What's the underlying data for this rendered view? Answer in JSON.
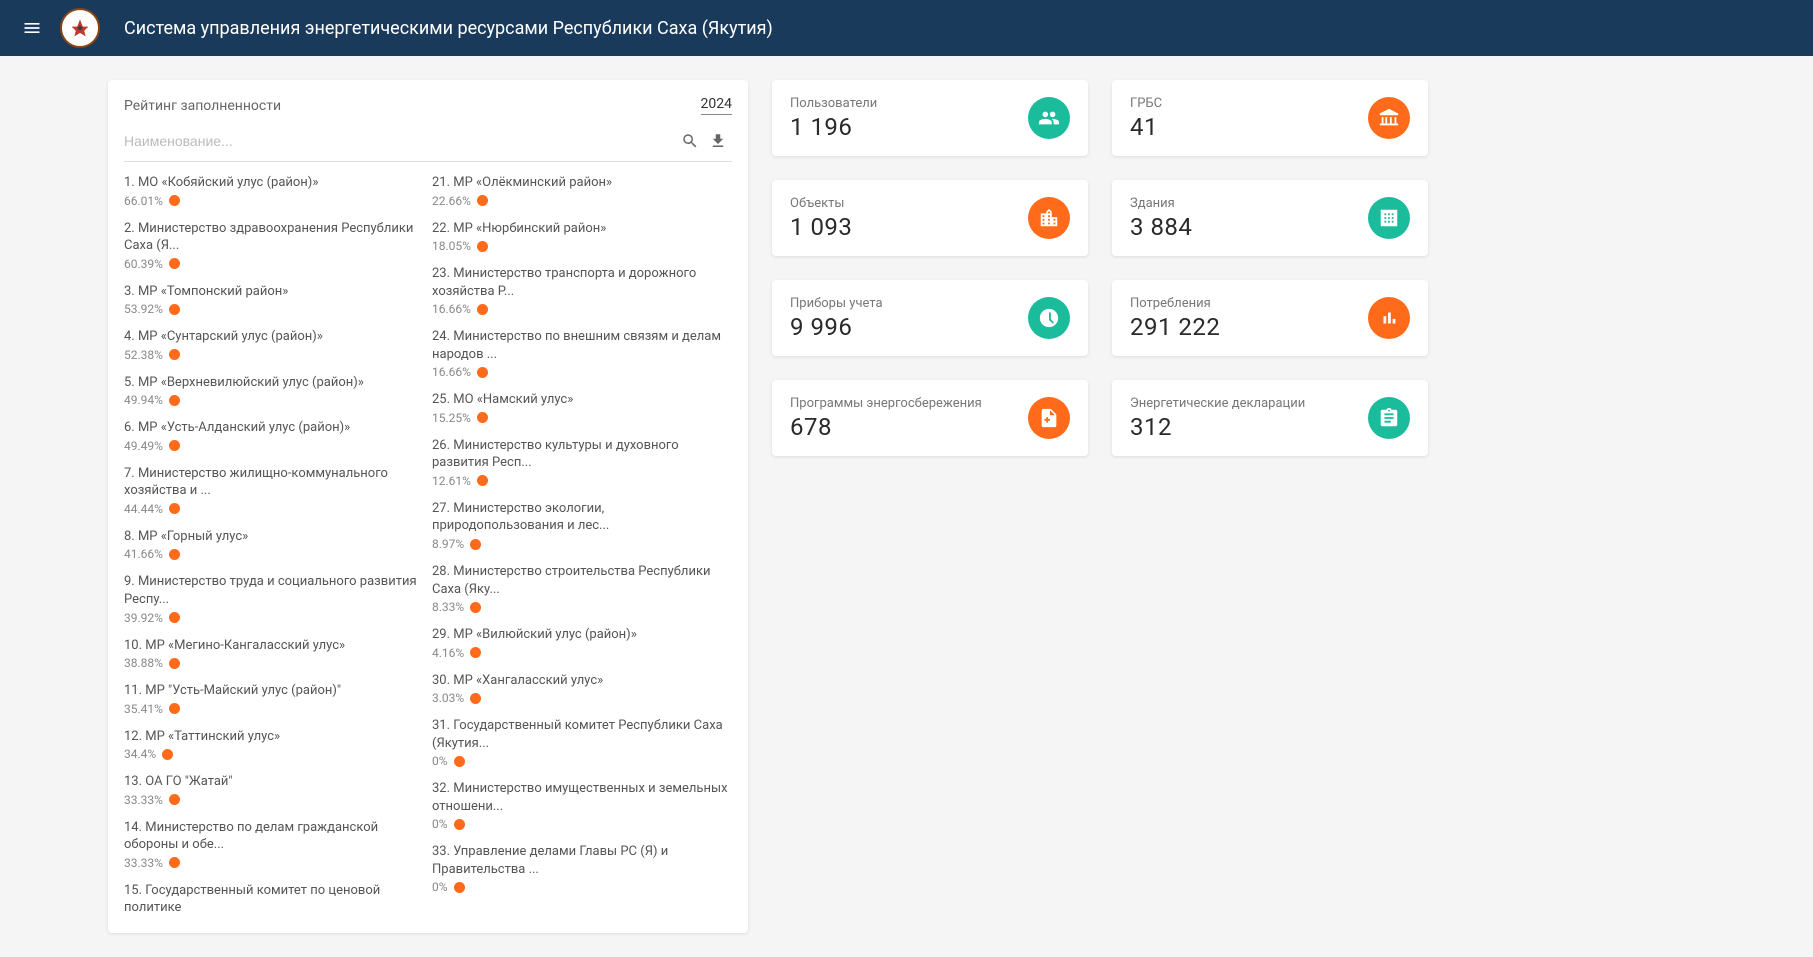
{
  "header": {
    "title": "Система управления энергетическими ресурсами Республики Саха (Якутия)"
  },
  "rating": {
    "title": "Рейтинг заполненности",
    "year": "2024",
    "search_placeholder": "Наименование...",
    "items": [
      {
        "name": "1. МО «Кобяйский улус (район)»",
        "pct": "66.01%"
      },
      {
        "name": "2. Министерство здравоохранения Республики Саха (Я...",
        "pct": "60.39%"
      },
      {
        "name": "3. МР «Томпонский район»",
        "pct": "53.92%"
      },
      {
        "name": "4. МР «Сунтарский улус (район)»",
        "pct": "52.38%"
      },
      {
        "name": "5. МР «Верхневилюйский улус (район)»",
        "pct": "49.94%"
      },
      {
        "name": "6. МР «Усть-Алданский улус (район)»",
        "pct": "49.49%"
      },
      {
        "name": "7. Министерство жилищно-коммунального хозяйства и ...",
        "pct": "44.44%"
      },
      {
        "name": "8. МР «Горный улус»",
        "pct": "41.66%"
      },
      {
        "name": "9. Министерство труда и социального развития Респу...",
        "pct": "39.92%"
      },
      {
        "name": "10. МР «Мегино-Кангаласский улус»",
        "pct": "38.88%"
      },
      {
        "name": "11. МР \"Усть-Майский улус (район)\"",
        "pct": "35.41%"
      },
      {
        "name": "12. МР «Таттинский улус»",
        "pct": "34.4%"
      },
      {
        "name": "13. ОА ГО \"Жатай\"",
        "pct": "33.33%"
      },
      {
        "name": "14. Министерство по делам гражданской обороны и обе...",
        "pct": "33.33%"
      },
      {
        "name": "15. Государственный комитет по ценовой политике",
        "pct": ""
      },
      {
        "name": "21. МР «Олёкминский район»",
        "pct": "22.66%"
      },
      {
        "name": "22. МР «Нюрбинский район»",
        "pct": "18.05%"
      },
      {
        "name": "23. Министерство транспорта и дорожного хозяйства Р...",
        "pct": "16.66%"
      },
      {
        "name": "24. Министерство по внешним связям и делам народов ...",
        "pct": "16.66%"
      },
      {
        "name": "25. МО «Намский улус»",
        "pct": "15.25%"
      },
      {
        "name": "26. Министерство культуры и духовного развития Респ...",
        "pct": "12.61%"
      },
      {
        "name": "27. Министерство экологии, природопользования и лес...",
        "pct": "8.97%"
      },
      {
        "name": "28. Министерство строительства Республики Саха (Яку...",
        "pct": "8.33%"
      },
      {
        "name": "29. МР «Вилюйский улус (район)»",
        "pct": "4.16%"
      },
      {
        "name": "30. МР «Хангаласский улус»",
        "pct": "3.03%"
      },
      {
        "name": "31. Государственный комитет Республики Саха (Якутия...",
        "pct": "0%"
      },
      {
        "name": "32. Министерство имущественных и земельных отношени...",
        "pct": "0%"
      },
      {
        "name": "33. Управление делами Главы РС (Я) и Правительства ...",
        "pct": "0%"
      }
    ]
  },
  "stats": [
    {
      "label": "Пользователи",
      "value": "1 196",
      "icon": "users",
      "color": "teal"
    },
    {
      "label": "ГРБС",
      "value": "41",
      "icon": "bank",
      "color": "orange"
    },
    {
      "label": "Объекты",
      "value": "1 093",
      "icon": "city",
      "color": "orange"
    },
    {
      "label": "Здания",
      "value": "3 884",
      "icon": "building",
      "color": "teal"
    },
    {
      "label": "Приборы учета",
      "value": "9 996",
      "icon": "meter",
      "color": "teal"
    },
    {
      "label": "Потребления",
      "value": "291 222",
      "icon": "chart",
      "color": "orange"
    },
    {
      "label": "Программы энергосбережения",
      "value": "678",
      "icon": "file",
      "color": "orange"
    },
    {
      "label": "Энергетические декларации",
      "value": "312",
      "icon": "clipboard",
      "color": "teal"
    }
  ]
}
